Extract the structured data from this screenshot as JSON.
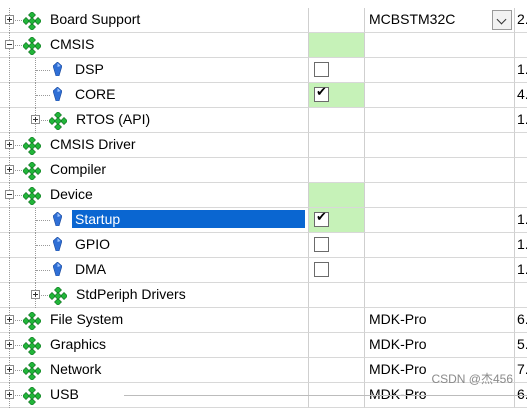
{
  "tree": [
    {
      "label": "Board Support",
      "kind": "group",
      "indent": 0,
      "expander": "plus",
      "checked": null,
      "green": false,
      "variant": "MCBSTM32C",
      "variant_dropdown": true,
      "version": "2."
    },
    {
      "label": "CMSIS",
      "kind": "group",
      "indent": 0,
      "expander": "minus",
      "checked": null,
      "green": true,
      "variant": "",
      "version": ""
    },
    {
      "label": "DSP",
      "kind": "component",
      "indent": 1,
      "expander": null,
      "checked": false,
      "green": false,
      "variant": "",
      "version": "1."
    },
    {
      "label": "CORE",
      "kind": "component",
      "indent": 1,
      "expander": null,
      "checked": true,
      "green": true,
      "variant": "",
      "version": "4."
    },
    {
      "label": "RTOS (API)",
      "kind": "group",
      "indent": 1,
      "expander": "plus",
      "checked": null,
      "green": false,
      "variant": "",
      "version": "1."
    },
    {
      "label": "CMSIS Driver",
      "kind": "group",
      "indent": 0,
      "expander": "plus",
      "checked": null,
      "green": false,
      "variant": "",
      "version": ""
    },
    {
      "label": "Compiler",
      "kind": "group",
      "indent": 0,
      "expander": "plus",
      "checked": null,
      "green": false,
      "variant": "",
      "version": ""
    },
    {
      "label": "Device",
      "kind": "group",
      "indent": 0,
      "expander": "minus",
      "checked": null,
      "green": true,
      "variant": "",
      "version": ""
    },
    {
      "label": "Startup",
      "kind": "component",
      "indent": 1,
      "expander": null,
      "checked": true,
      "green": true,
      "selected": true,
      "variant": "",
      "version": "1."
    },
    {
      "label": "GPIO",
      "kind": "component",
      "indent": 1,
      "expander": null,
      "checked": false,
      "green": false,
      "variant": "",
      "version": "1."
    },
    {
      "label": "DMA",
      "kind": "component",
      "indent": 1,
      "expander": null,
      "checked": false,
      "green": false,
      "variant": "",
      "version": "1."
    },
    {
      "label": "StdPeriph Drivers",
      "kind": "group",
      "indent": 1,
      "expander": "plus",
      "checked": null,
      "green": false,
      "variant": "",
      "version": ""
    },
    {
      "label": "File System",
      "kind": "group",
      "indent": 0,
      "expander": "plus",
      "checked": null,
      "green": false,
      "variant": "MDK-Pro",
      "version": "6."
    },
    {
      "label": "Graphics",
      "kind": "group",
      "indent": 0,
      "expander": "plus",
      "checked": null,
      "green": false,
      "variant": "MDK-Pro",
      "version": "5."
    },
    {
      "label": "Network",
      "kind": "group",
      "indent": 0,
      "expander": "plus",
      "checked": null,
      "green": false,
      "variant": "MDK-Pro",
      "version": "7."
    },
    {
      "label": "USB",
      "kind": "group",
      "indent": 0,
      "expander": "plus",
      "checked": null,
      "green": false,
      "variant": "MDK-Pro",
      "version": "6."
    }
  ],
  "watermark": "CSDN @杰456",
  "colors": {
    "selection": "#0a66d1",
    "selected_cell": "#c6f2b8",
    "group_icon": "#22b53a",
    "component_icon": "#2f6fd6"
  },
  "icons": {
    "group": "green-diamond-icon",
    "component": "blue-gem-icon"
  }
}
